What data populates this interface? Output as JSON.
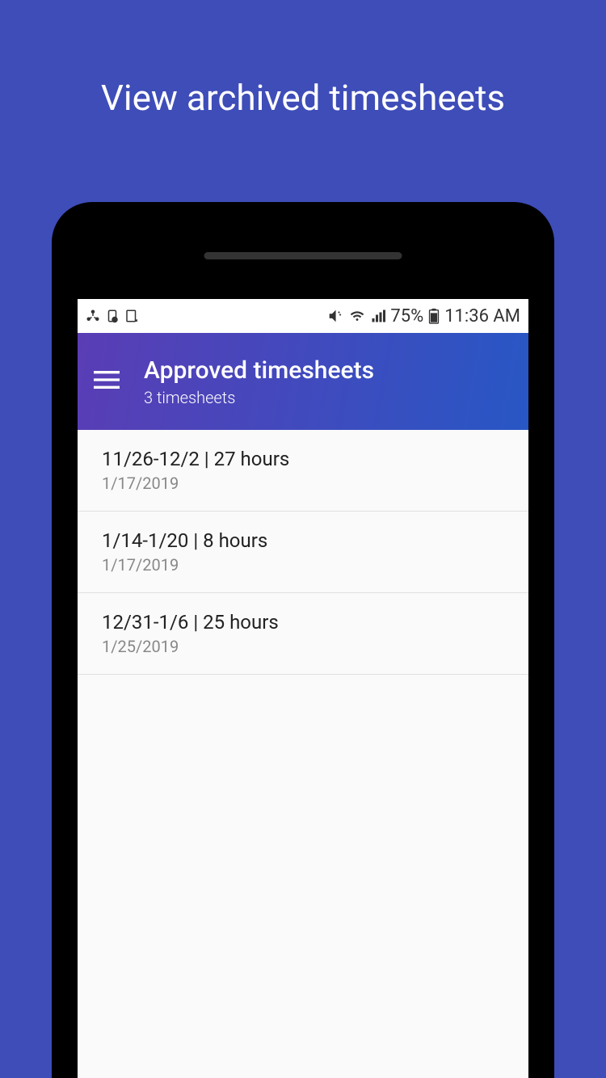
{
  "promo": {
    "title": "View archived timesheets"
  },
  "statusBar": {
    "battery": "75%",
    "time": "11:36 AM"
  },
  "header": {
    "title": "Approved timesheets",
    "subtitle": "3 timesheets"
  },
  "timesheets": [
    {
      "title": "11/26-12/2 | 27 hours",
      "date": "1/17/2019"
    },
    {
      "title": "1/14-1/20 | 8 hours",
      "date": "1/17/2019"
    },
    {
      "title": "12/31-1/6 | 25 hours",
      "date": "1/25/2019"
    }
  ]
}
